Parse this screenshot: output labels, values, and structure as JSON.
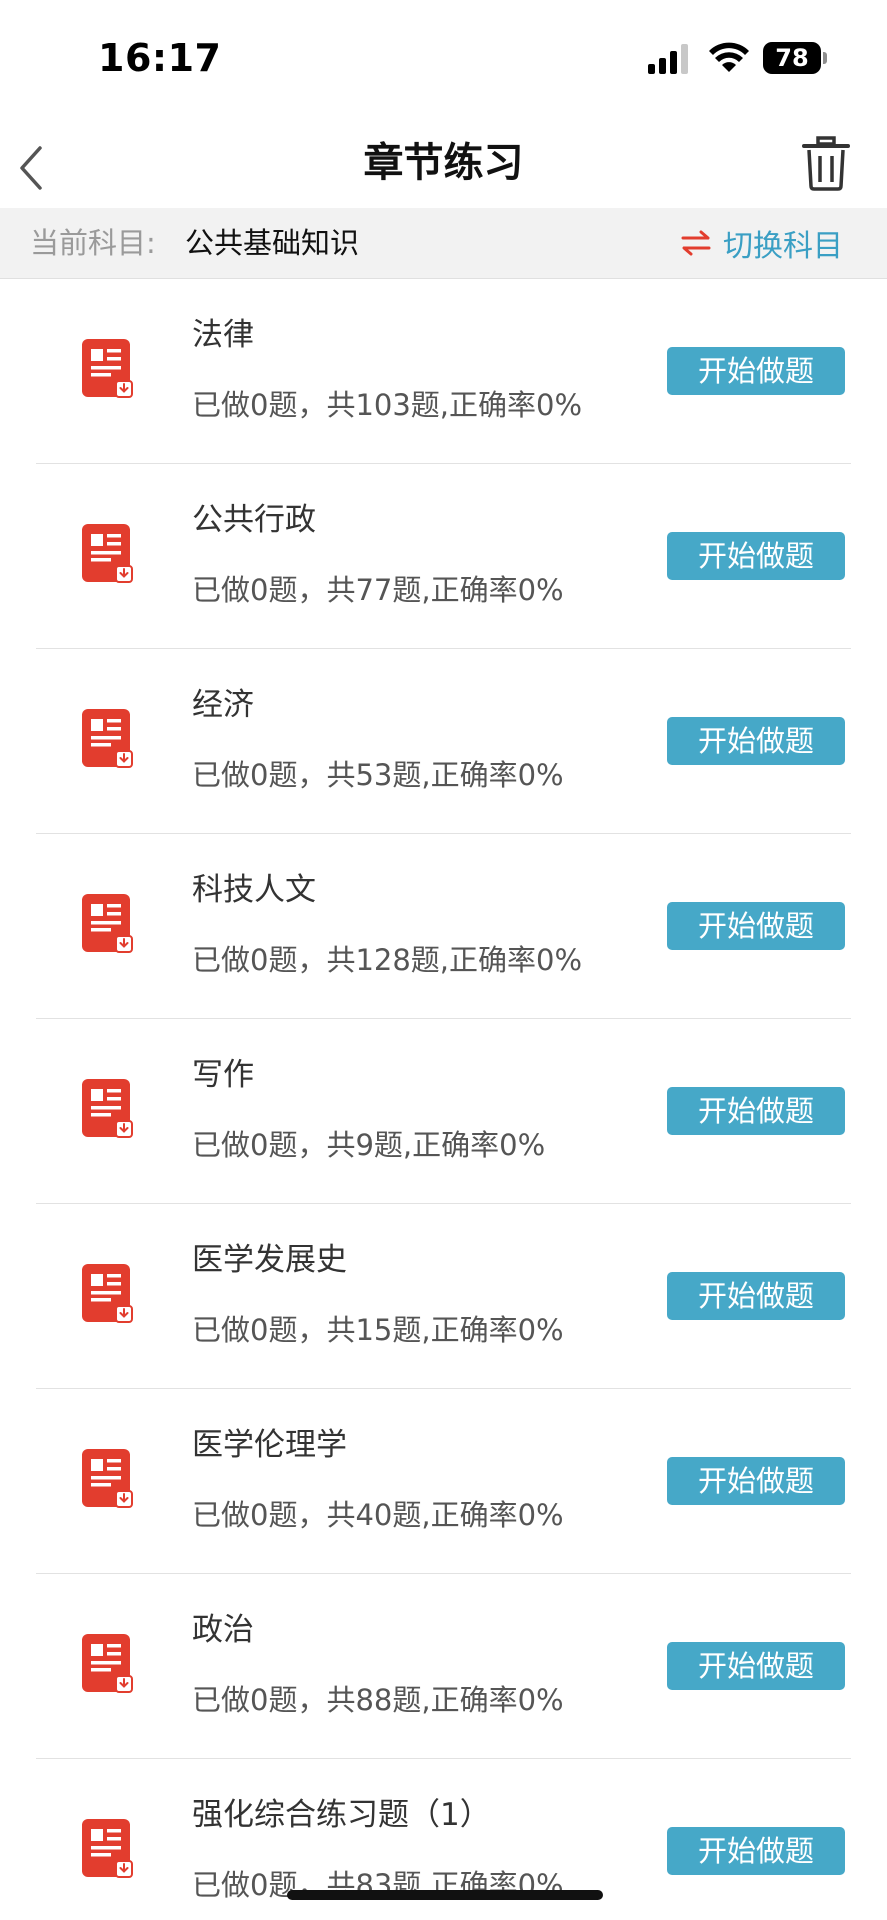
{
  "status_bar": {
    "time": "16:17",
    "battery_level": "78"
  },
  "nav": {
    "title": "章节练习",
    "back_icon": "chevron-left-icon",
    "trash_icon": "trash-icon"
  },
  "subject_bar": {
    "label": "当前科目:",
    "value": "公共基础知识",
    "switch_label": "切换科目",
    "switch_icon": "swap-arrows-icon"
  },
  "colors": {
    "accent": "#46a8c8",
    "icon_red": "#e23d2e",
    "switch_icon": "#e23d2e",
    "switch_text": "#3a9fc4"
  },
  "chapters": [
    {
      "title": "法律",
      "stats": "已做0题，共103题,正确率0%",
      "button": "开始做题"
    },
    {
      "title": "公共行政",
      "stats": "已做0题，共77题,正确率0%",
      "button": "开始做题"
    },
    {
      "title": "经济",
      "stats": "已做0题，共53题,正确率0%",
      "button": "开始做题"
    },
    {
      "title": "科技人文",
      "stats": "已做0题，共128题,正确率0%",
      "button": "开始做题"
    },
    {
      "title": "写作",
      "stats": "已做0题，共9题,正确率0%",
      "button": "开始做题"
    },
    {
      "title": "医学发展史",
      "stats": "已做0题，共15题,正确率0%",
      "button": "开始做题"
    },
    {
      "title": "医学伦理学",
      "stats": "已做0题，共40题,正确率0%",
      "button": "开始做题"
    },
    {
      "title": "政治",
      "stats": "已做0题，共88题,正确率0%",
      "button": "开始做题"
    },
    {
      "title": "强化综合练习题（1）",
      "stats": "已做0题，共83题,正确率0%",
      "button": "开始做题"
    }
  ]
}
